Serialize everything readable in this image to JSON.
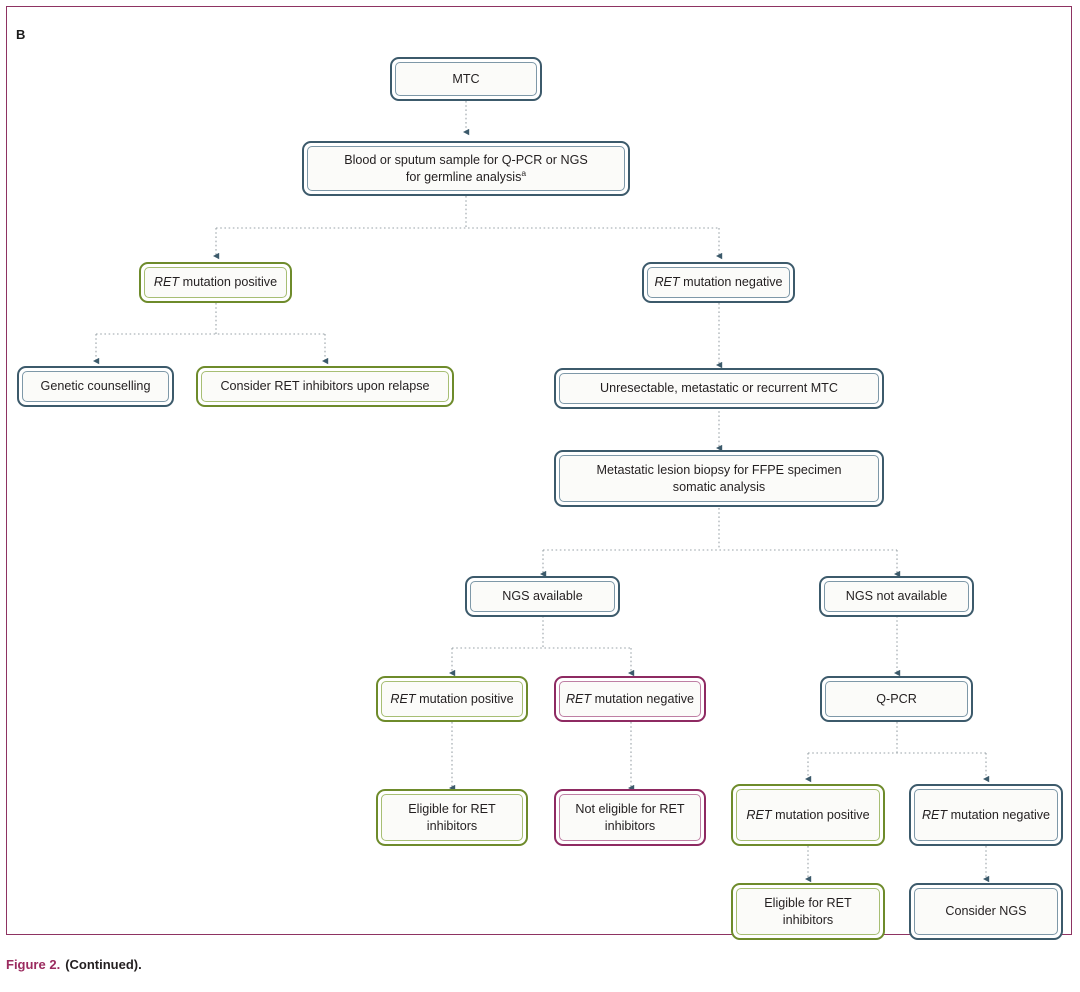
{
  "figure": {
    "panel_label": "B",
    "caption_number": "Figure 2.",
    "caption_text": "(Continued).",
    "frame_color": "#8E3362",
    "caption_number_color": "#9B2B5F"
  },
  "legend_colors": {
    "blue_border": "#3C5A6B",
    "green_border": "#6E8B2B",
    "plum_border": "#8E2A62",
    "connector": "#9AA3A8",
    "arrowhead": "#3C5A6B"
  },
  "nodes": {
    "mtc": "MTC",
    "germline_sample_line1": "Blood or sputum sample for Q-PCR or NGS",
    "germline_sample_line2": "for germline analysis",
    "germline_sample_superscript": "a",
    "germline_positive_gene": "RET",
    "germline_positive_rest": " mutation positive",
    "germline_negative_gene": "RET",
    "germline_negative_rest": " mutation negative",
    "genetic_counselling": "Genetic counselling",
    "consider_ret_inhibitors_relapse": "Consider RET inhibitors upon relapse",
    "unresectable": "Unresectable, metastatic or recurrent MTC",
    "biopsy_line1": "Metastatic lesion biopsy for FFPE specimen",
    "biopsy_line2": "somatic analysis",
    "ngs_available": "NGS available",
    "ngs_not_available": "NGS not available",
    "ngs_positive_gene": "RET",
    "ngs_positive_rest": " mutation positive",
    "ngs_negative_gene": "RET",
    "ngs_negative_rest": " mutation negative",
    "qpcr": "Q-PCR",
    "eligible_line1": "Eligible for RET",
    "eligible_line2": "inhibitors",
    "not_eligible_line1": "Not eligible for RET",
    "not_eligible_line2": "inhibitors",
    "qpcr_positive_gene": "RET",
    "qpcr_positive_rest": " mutation positive",
    "qpcr_negative_gene": "RET",
    "qpcr_negative_rest": " mutation negative",
    "qpcr_eligible_line1": "Eligible for RET",
    "qpcr_eligible_line2": "inhibitors",
    "consider_ngs": "Consider NGS"
  }
}
